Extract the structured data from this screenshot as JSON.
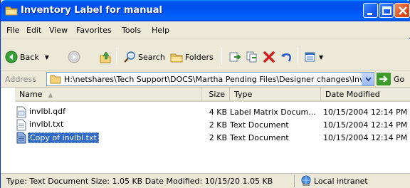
{
  "window": {
    "title": "Inventory Label for manual"
  },
  "menubar": {
    "items": [
      "File",
      "Edit",
      "View",
      "Favorites",
      "Tools",
      "Help"
    ]
  },
  "toolbar": {
    "back_label": "Back",
    "search_label": "Search",
    "folders_label": "Folders"
  },
  "addressbar": {
    "label": "Address",
    "value": "H:\\netshares\\Tech Support\\DOCS\\Martha Pending Files\\Designer changes\\Inve",
    "go_label": "Go"
  },
  "list": {
    "columns": [
      "Name",
      "Size",
      "Type",
      "Date Modified"
    ],
    "rows": [
      {
        "name": "invlbl.qdf",
        "size": "4 KB",
        "type": "Label Matrix Docum...",
        "modified": "10/15/2004 12:14 PM",
        "icon": "qdf-file-icon",
        "selected": false
      },
      {
        "name": "invlbl.txt",
        "size": "2 KB",
        "type": "Text Document",
        "modified": "10/15/2004 12:14 PM",
        "icon": "text-file-icon",
        "selected": false
      },
      {
        "name": "Copy of invlbl.txt",
        "size": "2 KB",
        "type": "Text Document",
        "modified": "10/15/2004 12:14 PM",
        "icon": "text-file-icon",
        "selected": true
      }
    ]
  },
  "statusbar": {
    "text": "Type: Text Document Size: 1.05 KB Date Modified: 10/15/20 1.05 KB",
    "zone": "Local intranet"
  },
  "colors": {
    "title_bar": "#0054e3",
    "selection": "#316ac5",
    "chrome": "#ece9d8"
  }
}
